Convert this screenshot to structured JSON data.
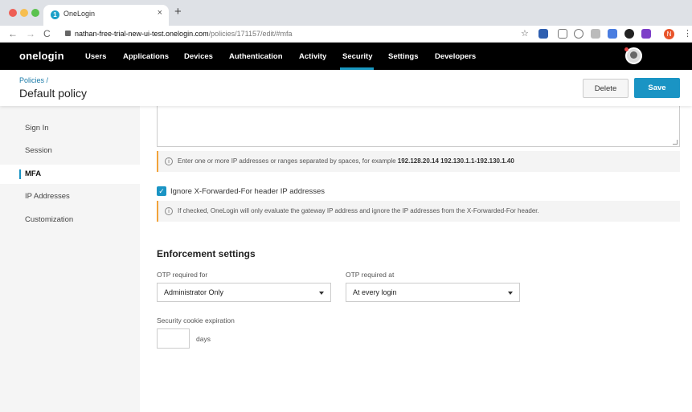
{
  "browser": {
    "tab_title": "OneLogin",
    "tab_favicon": "1",
    "tab_close": "×",
    "new_tab": "+",
    "url_host": "nathan-free-trial-new-ui-test.onelogin.com",
    "url_path": "/policies/171157/edit/#mfa",
    "profile_initial": "N",
    "icons": {
      "back": "←",
      "forward": "→",
      "reload": "C",
      "star": "☆",
      "menu": "⋮"
    }
  },
  "appnav": {
    "logo": "onelogin",
    "links": [
      "Users",
      "Applications",
      "Devices",
      "Authentication",
      "Activity",
      "Security",
      "Settings",
      "Developers"
    ],
    "active": "Security"
  },
  "page": {
    "breadcrumb": "Policies /",
    "title": "Default policy",
    "delete_label": "Delete",
    "save_label": "Save"
  },
  "sidebar": {
    "items": [
      {
        "label": "Sign In",
        "active": false
      },
      {
        "label": "Session",
        "active": false
      },
      {
        "label": "MFA",
        "active": true
      },
      {
        "label": "IP Addresses",
        "active": false
      },
      {
        "label": "Customization",
        "active": false
      }
    ]
  },
  "main": {
    "ip_info_prefix": "Enter one or more IP addresses or ranges separated by spaces, for example ",
    "ip_info_example": "192.128.20.14 192.130.1.1-192.130.1.40",
    "ignore_xff_label": "Ignore X-Forwarded-For header IP addresses",
    "ignore_xff_checked": true,
    "xff_info": "If checked, OneLogin will only evaluate the gateway IP address and ignore the IP addresses from the X-Forwarded-For header.",
    "enforcement_title": "Enforcement settings",
    "otp_for_label": "OTP required for",
    "otp_for_value": "Administrator Only",
    "otp_at_label": "OTP required at",
    "otp_at_value": "At every login",
    "cookie_label": "Security cookie expiration",
    "cookie_value": "",
    "days_label": "days"
  },
  "colors": {
    "accent": "#1a94c4",
    "info_border": "#f2a33a",
    "nav_bg": "#000000"
  }
}
